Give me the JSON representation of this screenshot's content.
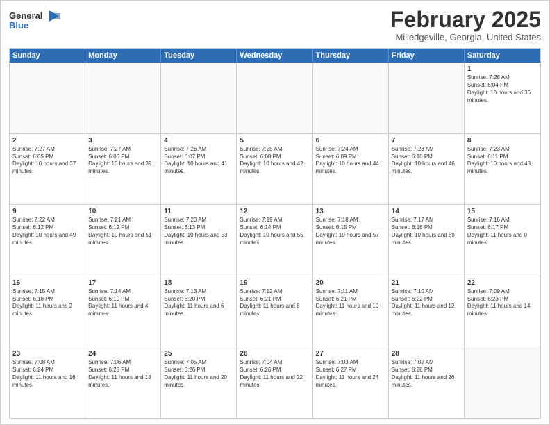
{
  "logo": {
    "line1": "General",
    "line2": "Blue",
    "icon_color": "#2e6db4"
  },
  "header": {
    "month": "February 2025",
    "location": "Milledgeville, Georgia, United States"
  },
  "days_of_week": [
    "Sunday",
    "Monday",
    "Tuesday",
    "Wednesday",
    "Thursday",
    "Friday",
    "Saturday"
  ],
  "weeks": [
    [
      {
        "day": "",
        "info": ""
      },
      {
        "day": "",
        "info": ""
      },
      {
        "day": "",
        "info": ""
      },
      {
        "day": "",
        "info": ""
      },
      {
        "day": "",
        "info": ""
      },
      {
        "day": "",
        "info": ""
      },
      {
        "day": "1",
        "info": "Sunrise: 7:28 AM\nSunset: 6:04 PM\nDaylight: 10 hours and 36 minutes."
      }
    ],
    [
      {
        "day": "2",
        "info": "Sunrise: 7:27 AM\nSunset: 6:05 PM\nDaylight: 10 hours and 37 minutes."
      },
      {
        "day": "3",
        "info": "Sunrise: 7:27 AM\nSunset: 6:06 PM\nDaylight: 10 hours and 39 minutes."
      },
      {
        "day": "4",
        "info": "Sunrise: 7:26 AM\nSunset: 6:07 PM\nDaylight: 10 hours and 41 minutes."
      },
      {
        "day": "5",
        "info": "Sunrise: 7:25 AM\nSunset: 6:08 PM\nDaylight: 10 hours and 42 minutes."
      },
      {
        "day": "6",
        "info": "Sunrise: 7:24 AM\nSunset: 6:09 PM\nDaylight: 10 hours and 44 minutes."
      },
      {
        "day": "7",
        "info": "Sunrise: 7:23 AM\nSunset: 6:10 PM\nDaylight: 10 hours and 46 minutes."
      },
      {
        "day": "8",
        "info": "Sunrise: 7:23 AM\nSunset: 6:11 PM\nDaylight: 10 hours and 48 minutes."
      }
    ],
    [
      {
        "day": "9",
        "info": "Sunrise: 7:22 AM\nSunset: 6:12 PM\nDaylight: 10 hours and 49 minutes."
      },
      {
        "day": "10",
        "info": "Sunrise: 7:21 AM\nSunset: 6:12 PM\nDaylight: 10 hours and 51 minutes."
      },
      {
        "day": "11",
        "info": "Sunrise: 7:20 AM\nSunset: 6:13 PM\nDaylight: 10 hours and 53 minutes."
      },
      {
        "day": "12",
        "info": "Sunrise: 7:19 AM\nSunset: 6:14 PM\nDaylight: 10 hours and 55 minutes."
      },
      {
        "day": "13",
        "info": "Sunrise: 7:18 AM\nSunset: 6:15 PM\nDaylight: 10 hours and 57 minutes."
      },
      {
        "day": "14",
        "info": "Sunrise: 7:17 AM\nSunset: 6:16 PM\nDaylight: 10 hours and 59 minutes."
      },
      {
        "day": "15",
        "info": "Sunrise: 7:16 AM\nSunset: 6:17 PM\nDaylight: 11 hours and 0 minutes."
      }
    ],
    [
      {
        "day": "16",
        "info": "Sunrise: 7:15 AM\nSunset: 6:18 PM\nDaylight: 11 hours and 2 minutes."
      },
      {
        "day": "17",
        "info": "Sunrise: 7:14 AM\nSunset: 6:19 PM\nDaylight: 11 hours and 4 minutes."
      },
      {
        "day": "18",
        "info": "Sunrise: 7:13 AM\nSunset: 6:20 PM\nDaylight: 11 hours and 6 minutes."
      },
      {
        "day": "19",
        "info": "Sunrise: 7:12 AM\nSunset: 6:21 PM\nDaylight: 11 hours and 8 minutes."
      },
      {
        "day": "20",
        "info": "Sunrise: 7:11 AM\nSunset: 6:21 PM\nDaylight: 11 hours and 10 minutes."
      },
      {
        "day": "21",
        "info": "Sunrise: 7:10 AM\nSunset: 6:22 PM\nDaylight: 11 hours and 12 minutes."
      },
      {
        "day": "22",
        "info": "Sunrise: 7:09 AM\nSunset: 6:23 PM\nDaylight: 11 hours and 14 minutes."
      }
    ],
    [
      {
        "day": "23",
        "info": "Sunrise: 7:08 AM\nSunset: 6:24 PM\nDaylight: 11 hours and 16 minutes."
      },
      {
        "day": "24",
        "info": "Sunrise: 7:06 AM\nSunset: 6:25 PM\nDaylight: 11 hours and 18 minutes."
      },
      {
        "day": "25",
        "info": "Sunrise: 7:05 AM\nSunset: 6:26 PM\nDaylight: 11 hours and 20 minutes."
      },
      {
        "day": "26",
        "info": "Sunrise: 7:04 AM\nSunset: 6:26 PM\nDaylight: 11 hours and 22 minutes."
      },
      {
        "day": "27",
        "info": "Sunrise: 7:03 AM\nSunset: 6:27 PM\nDaylight: 11 hours and 24 minutes."
      },
      {
        "day": "28",
        "info": "Sunrise: 7:02 AM\nSunset: 6:28 PM\nDaylight: 11 hours and 26 minutes."
      },
      {
        "day": "",
        "info": ""
      }
    ]
  ]
}
